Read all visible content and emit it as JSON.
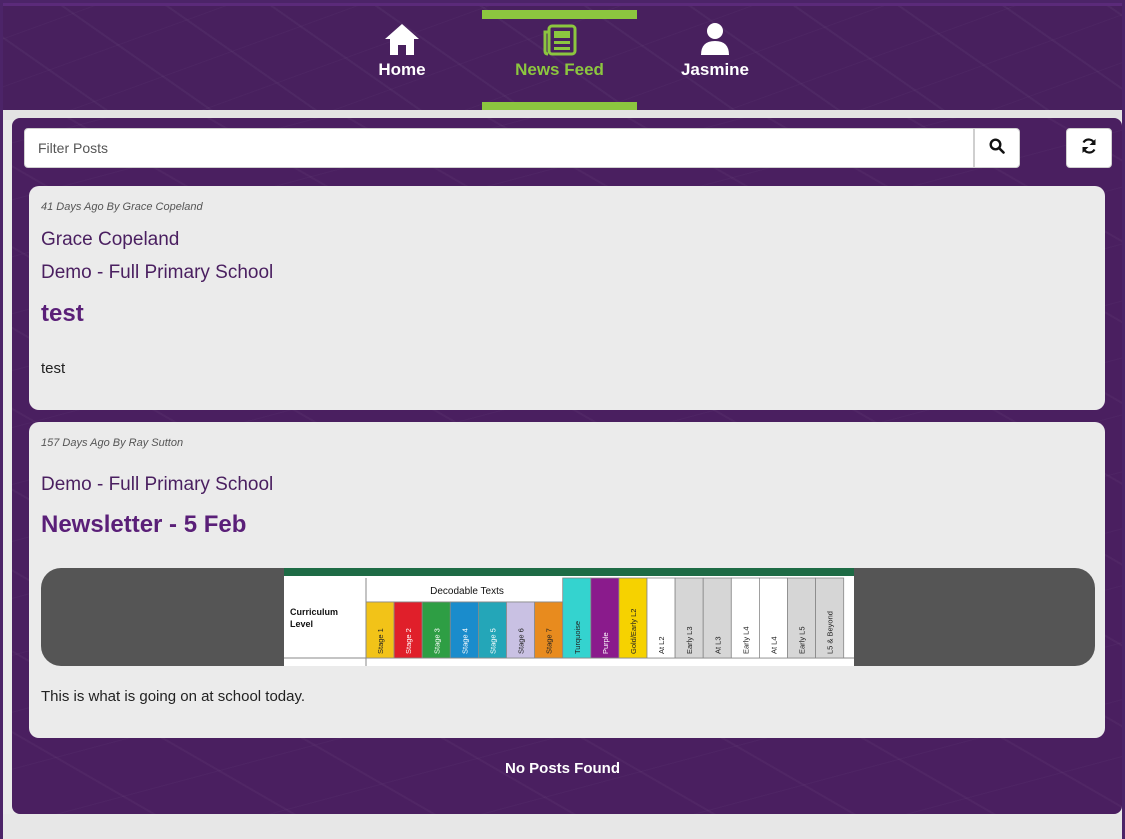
{
  "nav": {
    "items": [
      {
        "label": "Home",
        "icon": "home-icon"
      },
      {
        "label": "News Feed",
        "icon": "newspaper-icon",
        "active": true
      },
      {
        "label": "Jasmine",
        "icon": "user-icon"
      }
    ],
    "active_color": "#8cc63f"
  },
  "filter": {
    "placeholder": "Filter Posts",
    "value": ""
  },
  "posts": [
    {
      "meta": "41 Days Ago By Grace Copeland",
      "author": "Grace Copeland",
      "school": "Demo - Full Primary School",
      "title": "test",
      "body": "test"
    },
    {
      "meta": "157 Days Ago By Ray Sutton",
      "school": "Demo - Full Primary School",
      "title": "Newsletter - 5 Feb",
      "body": "This is what is going on at school today.",
      "image": {
        "heading": "Decodable Texts",
        "row_label": "Curriculum Level",
        "columns": [
          {
            "label": "Stage 1",
            "color": "#f2c318"
          },
          {
            "label": "Stage 2",
            "color": "#e01f2a"
          },
          {
            "label": "Stage 3",
            "color": "#2e9e44"
          },
          {
            "label": "Stage 4",
            "color": "#1a8ccc"
          },
          {
            "label": "Stage 5",
            "color": "#24a6b8"
          },
          {
            "label": "Stage 6",
            "color": "#c9c1e3"
          },
          {
            "label": "Stage 7",
            "color": "#e88b1e"
          },
          {
            "label": "Turquoise",
            "color": "#34d3cf"
          },
          {
            "label": "Purple",
            "color": "#8a1b8c"
          },
          {
            "label": "Gold/Early L2",
            "color": "#f6d200"
          },
          {
            "label": "At L2",
            "color": "#ffffff"
          },
          {
            "label": "Early L3",
            "color": "#d6d6d6"
          },
          {
            "label": "At L3",
            "color": "#d6d6d6"
          },
          {
            "label": "Early L4",
            "color": "#ffffff"
          },
          {
            "label": "At L4",
            "color": "#ffffff"
          },
          {
            "label": "Early L5",
            "color": "#d6d6d6"
          },
          {
            "label": "L5 & Beyond",
            "color": "#d6d6d6"
          }
        ]
      }
    }
  ],
  "empty_message": "No Posts Found",
  "colors": {
    "header_bg": "#48205e",
    "panel_bg": "#4a1f60",
    "card_bg": "#ebebeb",
    "title_color": "#5a1f78"
  }
}
